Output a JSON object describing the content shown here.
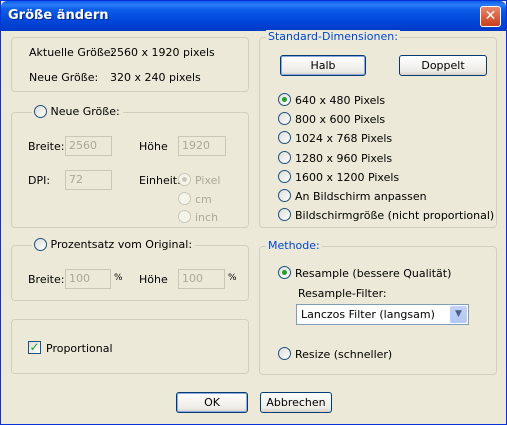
{
  "window": {
    "title": "Größe ändern",
    "close_symbol": "✕"
  },
  "size_info": {
    "current_label": "Aktuelle Größe:",
    "current_value": "2560  x  1920  pixels",
    "new_label": "Neue Größe:",
    "new_value": "320  x  240  pixels"
  },
  "new_size_group": {
    "radio_label": "Neue Größe:",
    "width_label": "Breite:",
    "width_value": "2560",
    "height_label": "Höhe",
    "height_value": "1920",
    "dpi_label": "DPI:",
    "dpi_value": "72",
    "unit_label": "Einheit:",
    "units": [
      "Pixel",
      "cm",
      "inch"
    ]
  },
  "percent_group": {
    "radio_label": "Prozentsatz vom Original:",
    "width_label": "Breite:",
    "width_value": "100",
    "width_unit": "%",
    "height_label": "Höhe",
    "height_value": "100",
    "height_unit": "%"
  },
  "proportional": {
    "label": "Proportional",
    "checked": true
  },
  "standard": {
    "legend": "Standard-Dimensionen:",
    "half_button": "Halb",
    "double_button": "Doppelt",
    "options": [
      "640 x 480 Pixels",
      "800 x 600 Pixels",
      "1024 x 768 Pixels",
      "1280 x 960 Pixels",
      "1600 x 1200 Pixels",
      "An Bildschirm anpassen",
      "Bildschirmgröße (nicht proportional)"
    ],
    "selected_index": 0
  },
  "method": {
    "legend": "Methode:",
    "resample_label": "Resample (bessere Qualität)",
    "filter_label": "Resample-Filter:",
    "filter_value": "Lanczos Filter (langsam)",
    "resize_label": "Resize (schneller)"
  },
  "buttons": {
    "ok": "OK",
    "cancel": "Abbrechen"
  },
  "colors": {
    "accent": "#0046d5",
    "titlebar": "#0a5be8",
    "face": "#ece9d8"
  }
}
